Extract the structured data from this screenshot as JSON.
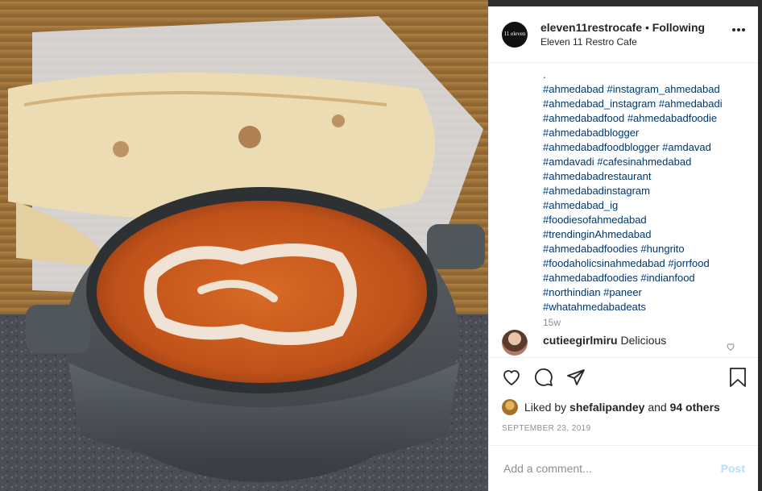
{
  "post": {
    "username": "eleven11restrocafe",
    "separator": "•",
    "follow_status": "Following",
    "display_name": "Eleven 11 Restro Cafe",
    "avatar_text": "11 eleven",
    "caption_lines": [
      ".",
      "#ahmedabad #instagram_ahmedabad",
      "#ahmedabad_instagram #ahmedabadi",
      "#ahmedabadfood #ahmedabadfoodie",
      "#ahmedabadblogger",
      "#ahmedabadfoodblogger #amdavad",
      "#amdavadi #cafesinahmedabad",
      "#ahmedabadrestaurant",
      "#ahmedabadinstagram",
      "#ahmedabad_ig",
      "#foodiesofahmedabad",
      "#trendinginAhmedabad",
      "#ahmedabadfoodies #hungrito",
      "#foodaholicsinahmedabad #jorrfood",
      "#ahmedabadfoodies #indianfood",
      "#northindian #paneer",
      "#whatahmedabadeats"
    ],
    "caption_age": "15w",
    "comment": {
      "user": "cutieegirlmiru",
      "text": "Delicious"
    },
    "likes": {
      "prefix": "Liked by",
      "user": "shefalipandey",
      "conj": "and",
      "others": "94 others"
    },
    "date": "SEPTEMBER 23, 2019",
    "add_comment_placeholder": "Add a comment...",
    "post_label": "Post"
  },
  "colors": {
    "hashtag": "#00376b",
    "post_button": "#b2dffc",
    "muted": "#8e8e8e"
  },
  "icons": [
    "more-options-icon",
    "like-icon",
    "comment-icon",
    "share-icon",
    "save-icon",
    "comment-like-icon"
  ]
}
